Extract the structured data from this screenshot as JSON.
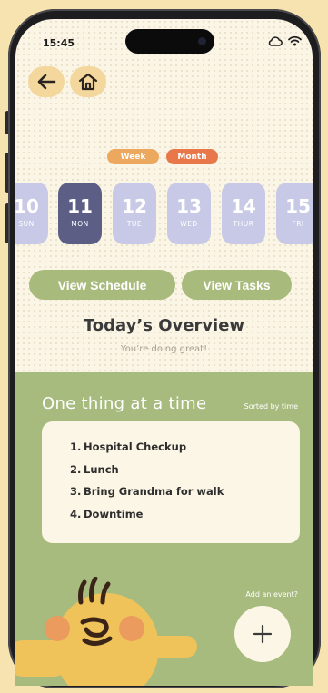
{
  "status_bar": {
    "time": "15:45"
  },
  "nav": {
    "back_icon": "arrow-left-icon",
    "home_icon": "home-icon"
  },
  "view_toggle": {
    "week": "Week",
    "month": "Month",
    "week_color": "#eba85e",
    "month_color": "#e8784a"
  },
  "days": [
    {
      "num": "10",
      "name": "SUN",
      "active": false
    },
    {
      "num": "11",
      "name": "MON",
      "active": true
    },
    {
      "num": "12",
      "name": "TUE",
      "active": false
    },
    {
      "num": "13",
      "name": "WED",
      "active": false
    },
    {
      "num": "14",
      "name": "THUR",
      "active": false
    },
    {
      "num": "15",
      "name": "FRI",
      "active": false
    }
  ],
  "actions": {
    "schedule": "View Schedule",
    "tasks": "View Tasks"
  },
  "overview": {
    "title": "Today’s Overview",
    "subtitle": "You’re doing great!"
  },
  "panel": {
    "title": "One thing at a time",
    "sort_label": "Sorted by time",
    "items": [
      {
        "index": "1.",
        "label": "Hospital Checkup"
      },
      {
        "index": "2.",
        "label": "Lunch"
      },
      {
        "index": "3.",
        "label": "Bring Grandma for walk"
      },
      {
        "index": "4.",
        "label": "Downtime"
      }
    ],
    "add_label": "Add an event?",
    "add_icon": "plus-icon"
  },
  "colors": {
    "accent_green": "#a8bb7e",
    "active_day": "#5c5e86",
    "inactive_day": "#c8c9e6",
    "background": "#fbf5e6"
  }
}
